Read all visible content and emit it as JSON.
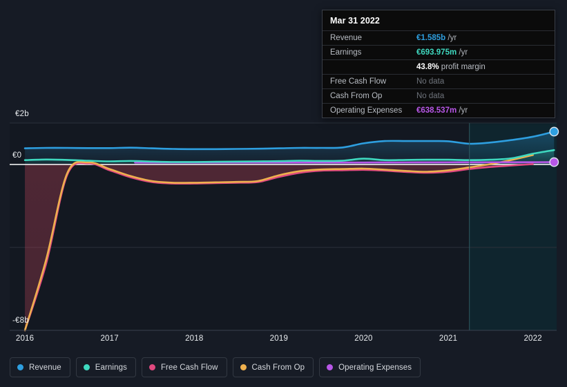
{
  "theme": {
    "background": "#161b25",
    "plot_background": "#131821",
    "highlight_background": "#10222a",
    "gridline": "#2b313b",
    "zero_line": "#ffffff",
    "axis_text": "#e9ecef"
  },
  "tooltip": {
    "date": "Mar 31 2022",
    "rows": [
      {
        "label": "Revenue",
        "amount": "€1.585b",
        "unit": "/yr",
        "color": "#2e9fe0",
        "no_data": false
      },
      {
        "label": "Earnings",
        "amount": "€693.975m",
        "unit": "/yr",
        "color": "#3fd9c0",
        "no_data": false
      },
      {
        "label": "",
        "amount": "43.8%",
        "unit": "profit margin",
        "color": "#ffffff",
        "no_data": false,
        "is_margin": true
      },
      {
        "label": "Free Cash Flow",
        "amount": "No data",
        "unit": "",
        "color": "#6f747c",
        "no_data": true
      },
      {
        "label": "Cash From Op",
        "amount": "No data",
        "unit": "",
        "color": "#6f747c",
        "no_data": true
      },
      {
        "label": "Operating Expenses",
        "amount": "€638.537m",
        "unit": "/yr",
        "color": "#b857e8",
        "no_data": false
      }
    ]
  },
  "legend": {
    "items": [
      {
        "label": "Revenue",
        "color": "#2e9fe0"
      },
      {
        "label": "Earnings",
        "color": "#3fd9c0"
      },
      {
        "label": "Free Cash Flow",
        "color": "#e0497f"
      },
      {
        "label": "Cash From Op",
        "color": "#eeb04e"
      },
      {
        "label": "Operating Expenses",
        "color": "#b857e8"
      }
    ]
  },
  "chart_data": {
    "type": "line",
    "title": "",
    "xlabel": "",
    "ylabel": "",
    "currency": "EUR",
    "xlim": [
      2015.82,
      2022.28
    ],
    "ylim": [
      -8.0,
      2.0
    ],
    "ytick_labels": [
      "€2b",
      "€0",
      "-€8b"
    ],
    "ytick_values": [
      2.0,
      0.0,
      -8.0
    ],
    "gridlines": [
      2.0,
      0.0,
      -4.0
    ],
    "grid": true,
    "legend_position": "bottom-left",
    "xtick_labels": [
      "2016",
      "2017",
      "2018",
      "2019",
      "2020",
      "2021",
      "2022"
    ],
    "xtick_values": [
      2016,
      2017,
      2018,
      2019,
      2020,
      2021,
      2022
    ],
    "forecast_divider_x": 2021.25,
    "annotations": [
      {
        "text": "highlighted period begins",
        "x": 2021.25
      }
    ],
    "series": [
      {
        "name": "Revenue",
        "color": "#2e9fe0",
        "filled": true,
        "x": [
          2016.0,
          2016.25,
          2016.5,
          2016.75,
          2017.0,
          2017.25,
          2017.5,
          2017.75,
          2018.0,
          2018.25,
          2018.5,
          2018.75,
          2019.0,
          2019.25,
          2019.5,
          2019.75,
          2020.0,
          2020.25,
          2020.5,
          2020.75,
          2021.0,
          2021.25,
          2021.5,
          2021.75,
          2022.0,
          2022.25
        ],
        "values": [
          0.78,
          0.8,
          0.8,
          0.79,
          0.79,
          0.81,
          0.78,
          0.75,
          0.74,
          0.74,
          0.75,
          0.76,
          0.78,
          0.8,
          0.8,
          0.82,
          1.02,
          1.13,
          1.13,
          1.13,
          1.12,
          1.0,
          1.06,
          1.18,
          1.34,
          1.585
        ],
        "endpoint_value": 1.585
      },
      {
        "name": "Earnings",
        "color": "#3fd9c0",
        "filled": true,
        "x": [
          2016.0,
          2016.25,
          2016.5,
          2016.75,
          2017.0,
          2017.25,
          2017.5,
          2017.75,
          2018.0,
          2018.25,
          2018.5,
          2018.75,
          2019.0,
          2019.25,
          2019.5,
          2019.75,
          2020.0,
          2020.25,
          2020.5,
          2020.75,
          2021.0,
          2021.25,
          2021.5,
          2021.75,
          2022.0,
          2022.25
        ],
        "values": [
          0.21,
          0.24,
          0.22,
          0.18,
          0.15,
          0.17,
          0.14,
          0.12,
          0.12,
          0.13,
          0.14,
          0.15,
          0.16,
          0.18,
          0.17,
          0.18,
          0.28,
          0.21,
          0.22,
          0.23,
          0.23,
          0.21,
          0.23,
          0.3,
          0.52,
          0.694
        ],
        "endpoint_value": 0.694
      },
      {
        "name": "Free Cash Flow",
        "color": "#e0497f",
        "filled": false,
        "x": [
          2016.0,
          2016.25,
          2016.5,
          2016.75,
          2017.0,
          2017.25,
          2017.5,
          2017.75,
          2018.0,
          2018.25,
          2018.5,
          2018.75,
          2019.0,
          2019.25,
          2019.5,
          2019.75,
          2020.0,
          2020.25,
          2020.5,
          2020.75,
          2021.0,
          2021.25,
          2021.5,
          2021.75,
          2022.0
        ],
        "values": [
          -8.0,
          -4.8,
          -0.5,
          0.05,
          -0.28,
          -0.62,
          -0.85,
          -0.92,
          -0.92,
          -0.9,
          -0.88,
          -0.85,
          -0.6,
          -0.4,
          -0.3,
          -0.28,
          -0.26,
          -0.3,
          -0.36,
          -0.4,
          -0.35,
          -0.22,
          -0.12,
          -0.05,
          0.02
        ],
        "no_data_from": 2022.0
      },
      {
        "name": "Cash From Op",
        "color": "#eeb04e",
        "filled": false,
        "x": [
          2016.0,
          2016.25,
          2016.5,
          2016.75,
          2017.0,
          2017.25,
          2017.5,
          2017.75,
          2018.0,
          2018.25,
          2018.5,
          2018.75,
          2019.0,
          2019.25,
          2019.5,
          2019.75,
          2020.0,
          2020.25,
          2020.5,
          2020.75,
          2021.0,
          2021.25,
          2021.5,
          2021.75,
          2022.0
        ],
        "values": [
          -8.0,
          -4.6,
          -0.42,
          0.1,
          -0.22,
          -0.56,
          -0.8,
          -0.88,
          -0.88,
          -0.86,
          -0.84,
          -0.8,
          -0.52,
          -0.32,
          -0.24,
          -0.22,
          -0.2,
          -0.25,
          -0.31,
          -0.35,
          -0.28,
          -0.14,
          0.02,
          0.22,
          0.46
        ],
        "no_data_from": 2022.0
      },
      {
        "name": "Operating Expenses",
        "color": "#b857e8",
        "filled": true,
        "x": [
          2017.3,
          2017.5,
          2017.75,
          2018.0,
          2018.25,
          2018.5,
          2018.75,
          2019.0,
          2019.25,
          2019.5,
          2019.75,
          2020.0,
          2020.25,
          2020.5,
          2020.75,
          2021.0,
          2021.25,
          2021.5,
          2021.75,
          2022.0,
          2022.25
        ],
        "values": [
          0.095,
          0.095,
          0.095,
          0.095,
          0.095,
          0.095,
          0.095,
          0.095,
          0.095,
          0.095,
          0.095,
          0.095,
          0.098,
          0.1,
          0.102,
          0.104,
          0.106,
          0.108,
          0.11,
          0.112,
          0.1145
        ],
        "endpoint_value": 0.6385
      }
    ]
  }
}
